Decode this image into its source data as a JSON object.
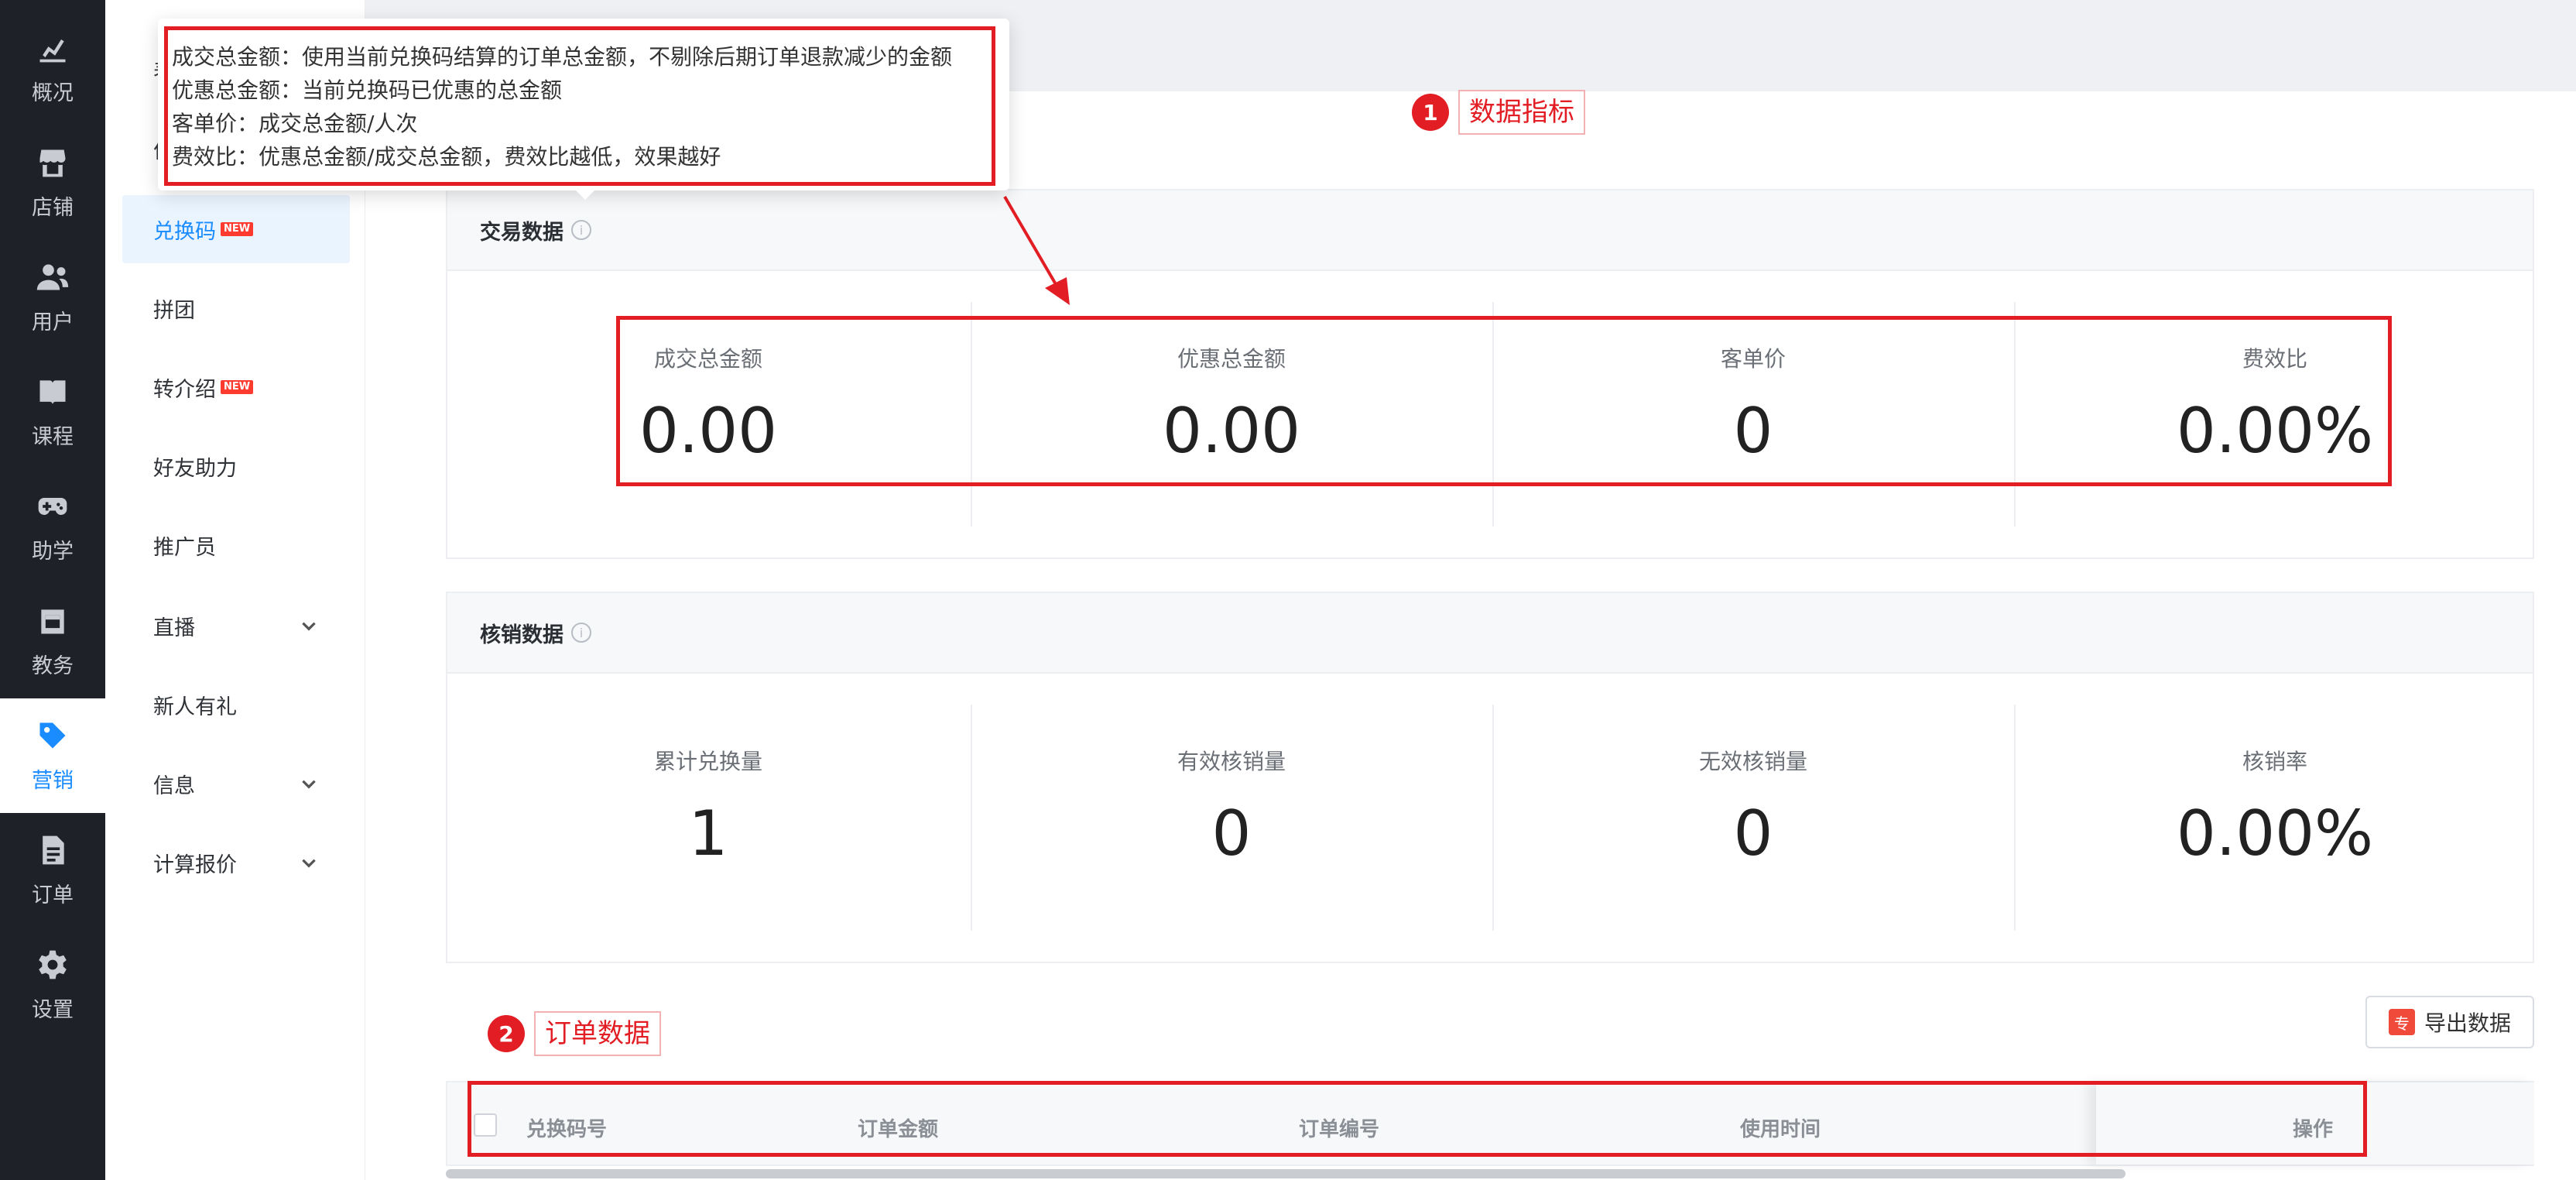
{
  "nav": {
    "items": [
      {
        "label": "概况",
        "icon": "chart-icon"
      },
      {
        "label": "店铺",
        "icon": "store-icon"
      },
      {
        "label": "用户",
        "icon": "users-icon"
      },
      {
        "label": "课程",
        "icon": "book-icon"
      },
      {
        "label": "助学",
        "icon": "gamepad-icon"
      },
      {
        "label": "教务",
        "icon": "calendar-icon"
      },
      {
        "label": "营销",
        "icon": "tag-icon",
        "active": true
      },
      {
        "label": "订单",
        "icon": "document-icon"
      },
      {
        "label": "设置",
        "icon": "gear-icon"
      }
    ]
  },
  "submenu": {
    "items": [
      {
        "label": "表"
      },
      {
        "label": "优"
      },
      {
        "label": "兑换码",
        "badge": "NEW",
        "active": true
      },
      {
        "label": "拼团"
      },
      {
        "label": "转介绍",
        "badge": "NEW"
      },
      {
        "label": "好友助力"
      },
      {
        "label": "推广员"
      },
      {
        "label": "直播",
        "expandable": true
      },
      {
        "label": "新人有礼"
      },
      {
        "label": "信息",
        "expandable": true
      },
      {
        "label": "计算报价",
        "expandable": true
      }
    ]
  },
  "tooltip": {
    "lines": [
      "成交总金额：使用当前兑换码结算的订单总金额，不剔除后期订单退款减少的金额",
      "优惠总金额：当前兑换码已优惠的总金额",
      "客单价：成交总金额/人次",
      "费效比：优惠总金额/成交总金额，费效比越低，效果越好"
    ]
  },
  "annotations": [
    {
      "number": "1",
      "text": "数据指标"
    },
    {
      "number": "2",
      "text": "订单数据"
    }
  ],
  "trade": {
    "title": "交易数据",
    "metrics": [
      {
        "label": "成交总金额",
        "value": "0.00"
      },
      {
        "label": "优惠总金额",
        "value": "0.00"
      },
      {
        "label": "客单价",
        "value": "0"
      },
      {
        "label": "费效比",
        "value": "0.00%"
      }
    ]
  },
  "redeem": {
    "title": "核销数据",
    "metrics": [
      {
        "label": "累计兑换量",
        "value": "1"
      },
      {
        "label": "有效核销量",
        "value": "0"
      },
      {
        "label": "无效核销量",
        "value": "0"
      },
      {
        "label": "核销率",
        "value": "0.00%"
      }
    ]
  },
  "export": {
    "icon_label": "专",
    "label": "导出数据"
  },
  "table": {
    "columns": [
      "兑换码号",
      "订单金额",
      "订单编号",
      "使用时间",
      "操作"
    ]
  },
  "colors": {
    "accent": "#1a8cff",
    "annotation_red": "#e21d24",
    "nav_bg": "#1e2228"
  }
}
